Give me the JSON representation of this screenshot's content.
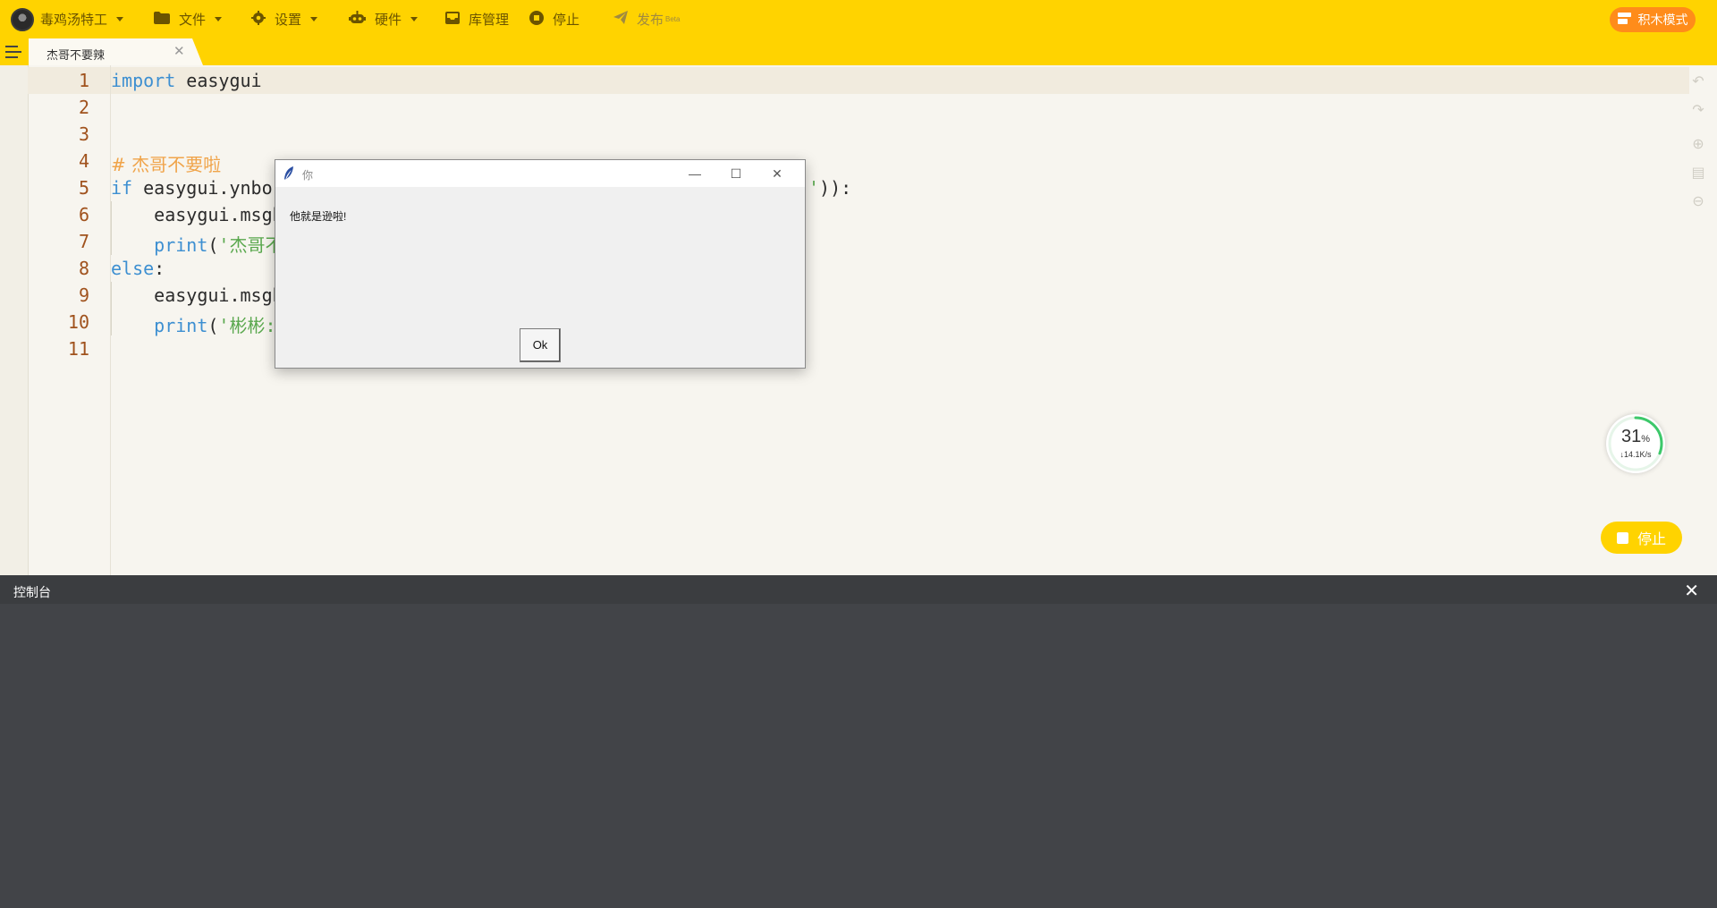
{
  "topbar": {
    "user_name": "毒鸡汤特工",
    "menus": [
      {
        "label": "文件",
        "icon": "folder-icon"
      },
      {
        "label": "设置",
        "icon": "gear-icon"
      },
      {
        "label": "硬件",
        "icon": "robot-icon"
      },
      {
        "label": "库管理",
        "icon": "inbox-icon"
      },
      {
        "label": "停止",
        "icon": "stop-circle-icon"
      },
      {
        "label": "发布",
        "icon": "paper-plane-icon",
        "badge": "Beta"
      }
    ],
    "block_mode_label": "积木模式",
    "accent_color": "#ffd300",
    "block_mode_color": "#ff8c1a"
  },
  "tabs": [
    {
      "label": "杰哥不要辣",
      "active": true
    }
  ],
  "editor": {
    "line_numbers": [
      "1",
      "2",
      "3",
      "4",
      "5",
      "6",
      "7",
      "8",
      "9",
      "10",
      "11"
    ],
    "lines": {
      "l1_kw": "import",
      "l1_rest": " easygui",
      "l4": "# 杰哥不要啦",
      "l5_kw": "if",
      "l5_a": " easygui.ynbo",
      "l5_str": "'",
      "l5_b": ")):",
      "l6": "    easygui.msgb",
      "l7_fn": "    print",
      "l7_p": "(",
      "l7_str": "'杰哥不",
      "l8_kw": "else",
      "l8_rest": ":",
      "l9": "    easygui.msgb",
      "l10_fn": "    print",
      "l10_p": "(",
      "l10_str": "'彬彬:"
    }
  },
  "network": {
    "percent": "31",
    "percent_unit": "%",
    "rate": "↓14.1K/s",
    "progress_fraction": 0.31
  },
  "floating_stop_label": "停止",
  "dialog": {
    "title": "你",
    "message": "他就是逊啦!",
    "ok_label": "Ok",
    "minimize_glyph": "—",
    "maximize_glyph": "☐",
    "close_glyph": "✕"
  },
  "console": {
    "title": "控制台",
    "close_glyph": "✕"
  }
}
